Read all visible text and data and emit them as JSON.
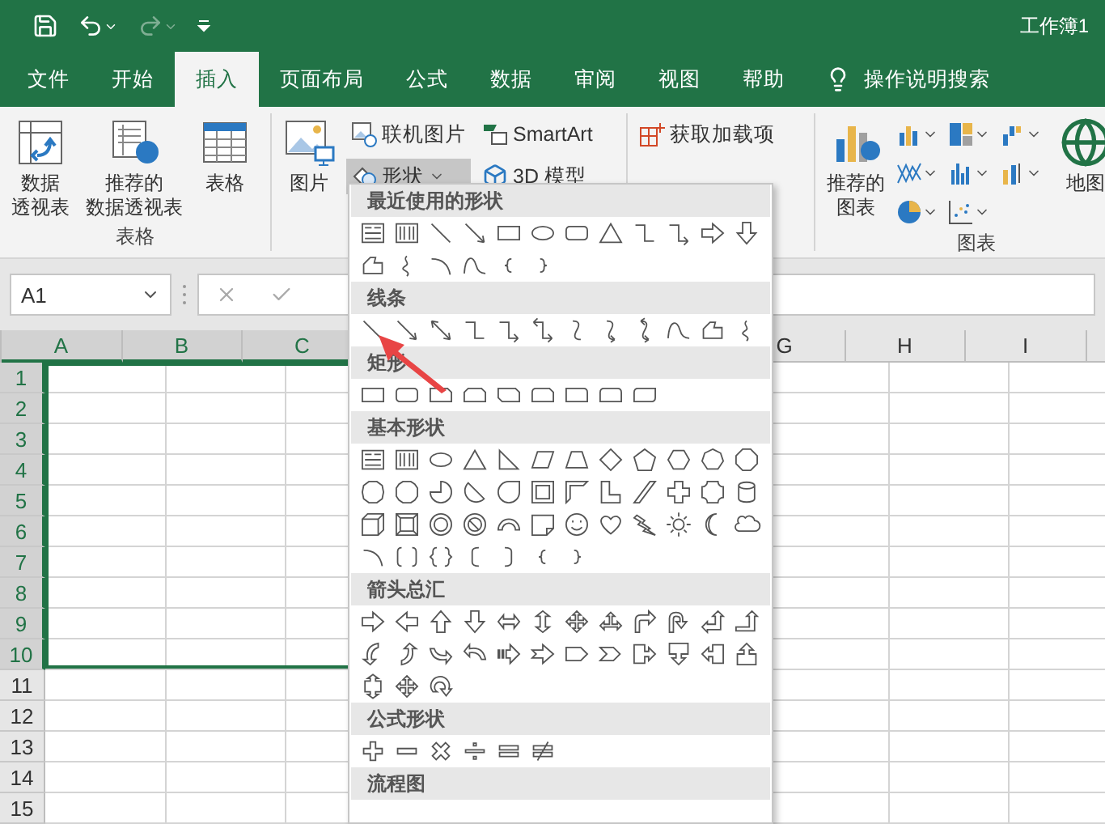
{
  "title_bar": {
    "title": "工作簿1"
  },
  "tabs": [
    {
      "label": "文件",
      "selected": false
    },
    {
      "label": "开始",
      "selected": false
    },
    {
      "label": "插入",
      "selected": true
    },
    {
      "label": "页面布局",
      "selected": false
    },
    {
      "label": "公式",
      "selected": false
    },
    {
      "label": "数据",
      "selected": false
    },
    {
      "label": "审阅",
      "selected": false
    },
    {
      "label": "视图",
      "selected": false
    },
    {
      "label": "帮助",
      "selected": false
    }
  ],
  "tell_me": {
    "label": "操作说明搜索"
  },
  "ribbon": {
    "groups": [
      {
        "label": "表格",
        "buttons": [
          {
            "kind": "pivot",
            "lines": [
              "数据",
              "透视表"
            ],
            "pressed": false
          },
          {
            "kind": "recommended_pivot",
            "lines": [
              "推荐的",
              "数据透视表"
            ],
            "pressed": false
          },
          {
            "kind": "table",
            "label": "表格",
            "pressed": false
          }
        ]
      },
      {
        "buttons": [
          {
            "kind": "picture",
            "label": "图片",
            "pressed": false
          },
          {
            "kind": "online_picture",
            "label": "联机图片",
            "pressed": false
          },
          {
            "kind": "shapes",
            "label": "形状",
            "pressed": true
          },
          {
            "kind": "smartart",
            "label": "SmartArt",
            "pressed": false
          },
          {
            "kind": "model_3d",
            "label": "3D 模型",
            "pressed": false
          }
        ]
      },
      {
        "buttons": [
          {
            "kind": "get_addins",
            "label": "获取加载项",
            "pressed": false
          }
        ]
      },
      {
        "label": "图表",
        "buttons": [
          {
            "kind": "recommended_chart",
            "lines": [
              "推荐的",
              "图表"
            ],
            "pressed": false
          },
          {
            "kind": "map",
            "label": "地图",
            "pressed": false
          }
        ]
      }
    ]
  },
  "name_box": {
    "value": "A1"
  },
  "columns": [
    {
      "label": "A",
      "selected": true
    },
    {
      "label": "B",
      "selected": true
    },
    {
      "label": "C",
      "selected": true
    },
    {
      "label": "G",
      "selected": false
    },
    {
      "label": "H",
      "selected": false
    },
    {
      "label": "I",
      "selected": false
    }
  ],
  "rows": [
    {
      "label": "1",
      "selected": true
    },
    {
      "label": "2",
      "selected": true
    },
    {
      "label": "3",
      "selected": true
    },
    {
      "label": "4",
      "selected": true
    },
    {
      "label": "5",
      "selected": true
    },
    {
      "label": "6",
      "selected": true
    },
    {
      "label": "7",
      "selected": true
    },
    {
      "label": "8",
      "selected": true
    },
    {
      "label": "9",
      "selected": true
    },
    {
      "label": "10",
      "selected": true
    },
    {
      "label": "11",
      "selected": false
    },
    {
      "label": "12",
      "selected": false
    },
    {
      "label": "13",
      "selected": false
    },
    {
      "label": "14",
      "selected": false
    },
    {
      "label": "15",
      "selected": false
    }
  ],
  "shapes_menu": {
    "sections": [
      {
        "title": "最近使用的形状"
      },
      {
        "title": "线条"
      },
      {
        "title": "矩形"
      },
      {
        "title": "基本形状"
      },
      {
        "title": "箭头总汇"
      },
      {
        "title": "公式形状"
      },
      {
        "title": "流程图"
      }
    ]
  }
}
